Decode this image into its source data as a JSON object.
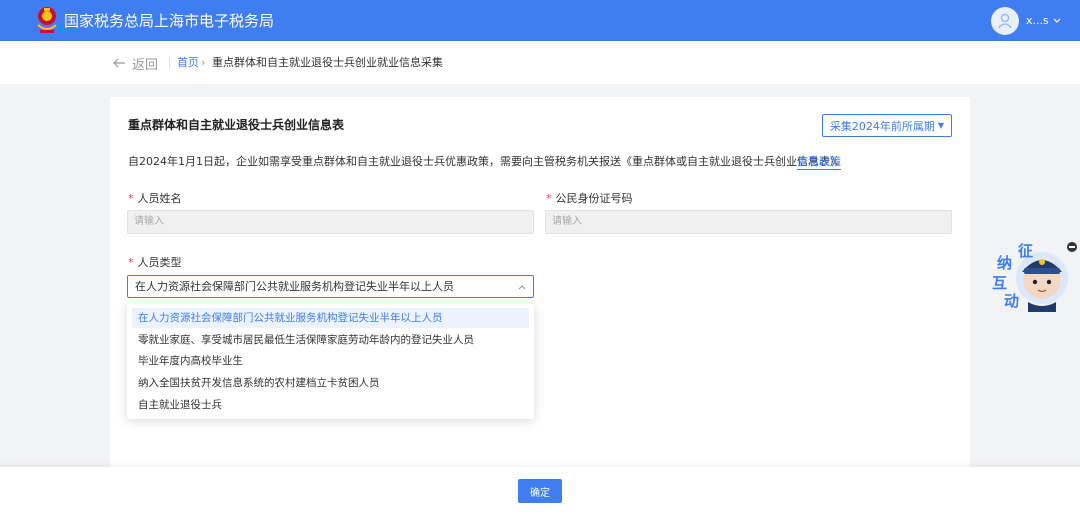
{
  "colors": {
    "primary": "#3f7df1",
    "required": "#e5484d",
    "page_bg": "#f2f3f5"
  },
  "header": {
    "title": "国家税务总局上海市电子税务局",
    "emblem_icon": "tax-emblem-icon",
    "user": {
      "name": "x...s",
      "avatar_icon": "user-avatar-icon",
      "caret_icon": "chevron-down-icon"
    }
  },
  "nav": {
    "back_label": "返回",
    "back_icon": "arrow-left-icon",
    "breadcrumb": {
      "home": "首页",
      "separator": "›",
      "current": "重点群体和自主就业退役士兵创业就业信息采集"
    }
  },
  "form": {
    "title": "重点群体和自主就业退役士兵创业信息表",
    "period_button": "采集2024年前所属期",
    "notice": "自2024年1月1日起，企业如需享受重点群体和自主就业退役士兵优惠政策，需要向主管税务机关报送《重点群体或自主就业退役士兵创业信息表》。",
    "policy_link": "查看政策",
    "required_mark": "*",
    "fields": {
      "name": {
        "label": "人员姓名",
        "placeholder": "请输入"
      },
      "id_number": {
        "label": "公民身份证号码",
        "placeholder": "请输入"
      },
      "person_type": {
        "label": "人员类型",
        "value": "在人力资源社会保障部门公共就业服务机构登记失业半年以上人员",
        "options": [
          "在人力资源社会保障部门公共就业服务机构登记失业半年以上人员",
          "零就业家庭、享受城市居民最低生活保障家庭劳动年龄内的登记失业人员",
          "毕业年度内高校毕业生",
          "纳入全国扶贫开发信息系统的农村建档立卡贫困人员",
          "自主就业退役士兵"
        ],
        "selected_index": 0
      }
    }
  },
  "footer": {
    "confirm_label": "确定"
  },
  "float_widget": {
    "text": [
      "征",
      "纳",
      "互",
      "动"
    ],
    "icon": "mascot-icon",
    "close_icon": "minus-icon"
  }
}
